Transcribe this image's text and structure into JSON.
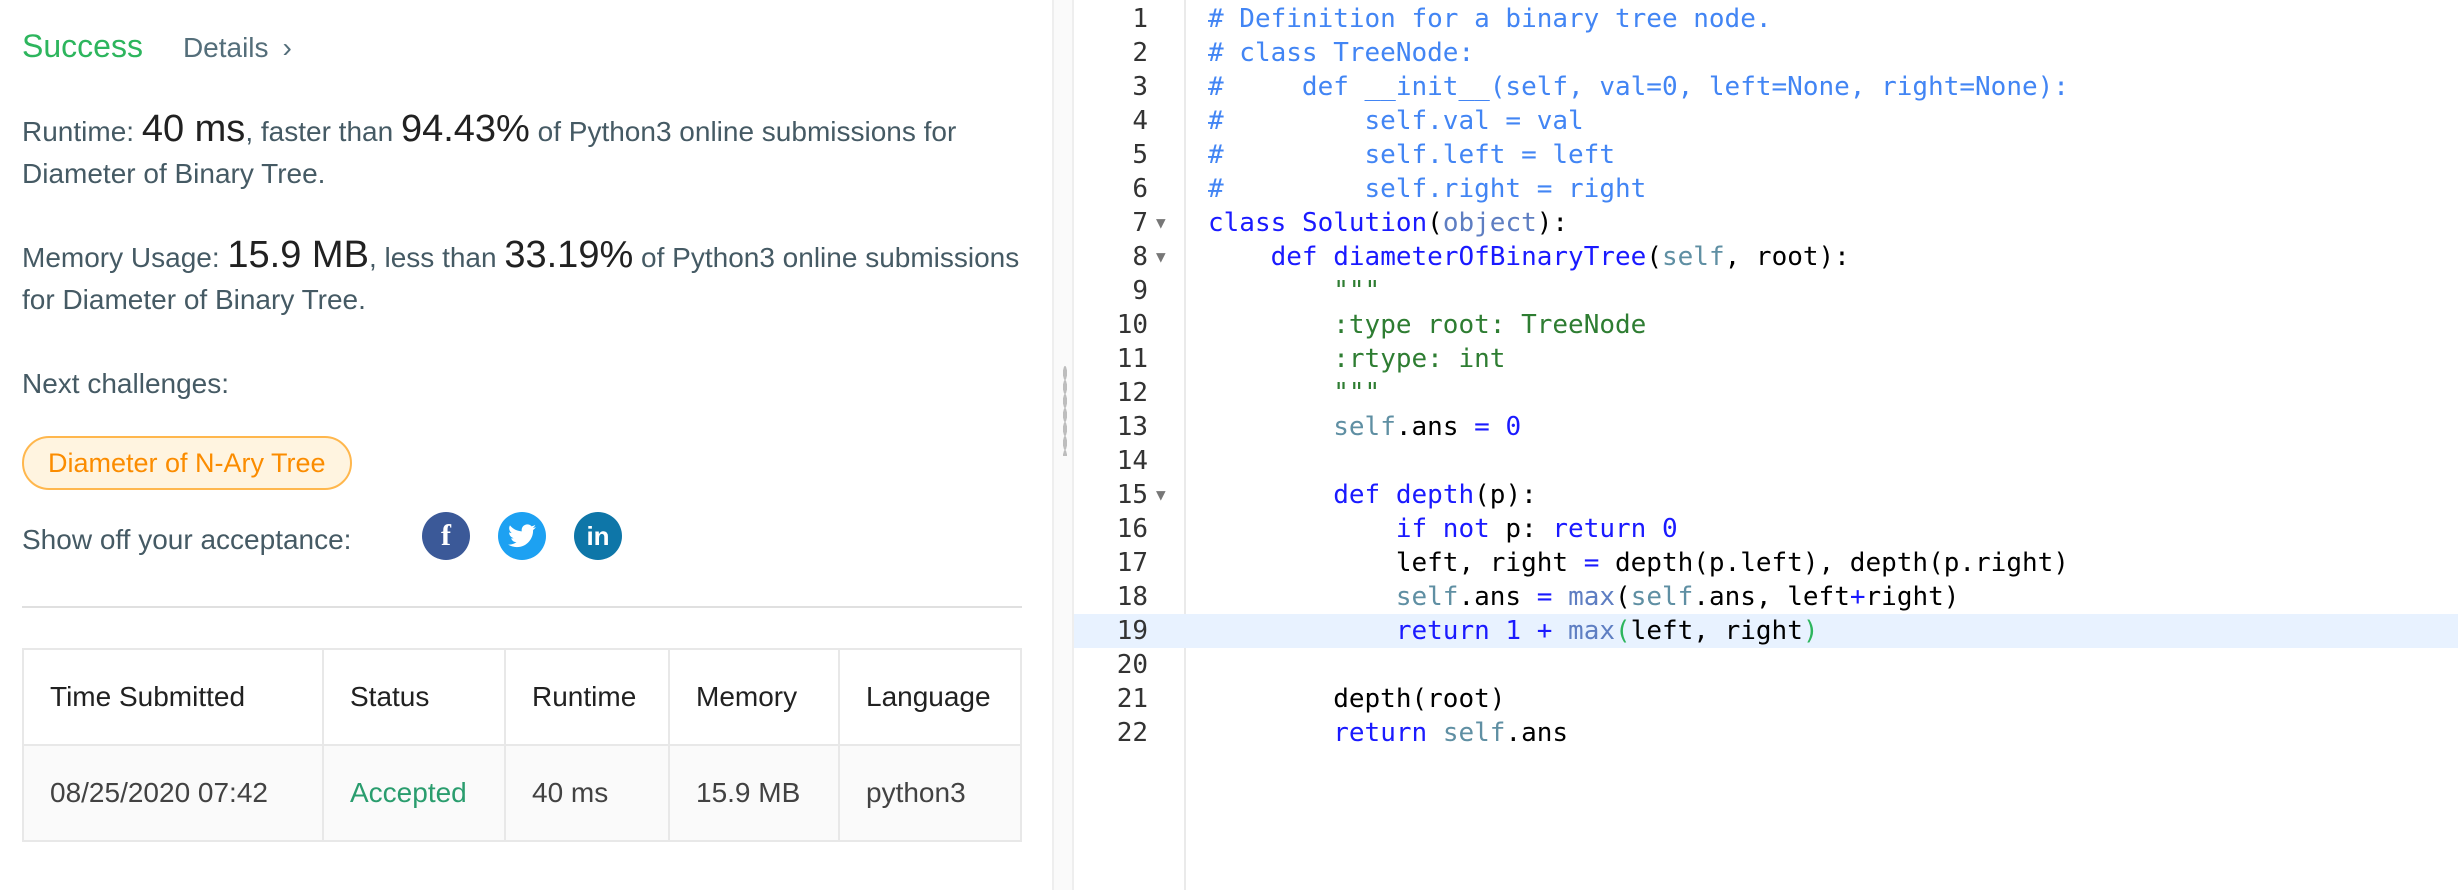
{
  "header": {
    "status": "Success",
    "details_label": "Details",
    "details_chevron": "›"
  },
  "runtime": {
    "label": "Runtime:",
    "value": "40 ms",
    "mid": ", faster than",
    "percent": "94.43%",
    "tail": "of Python3 online submissions for Diameter of Binary Tree."
  },
  "memory": {
    "label": "Memory Usage:",
    "value": "15.9 MB",
    "mid": ", less than",
    "percent": "33.19%",
    "tail": "of Python3 online submissions for Diameter of Binary Tree."
  },
  "next": {
    "label": "Next challenges:",
    "chip": "Diameter of N-Ary Tree"
  },
  "share": {
    "label": "Show off your acceptance:",
    "icons": [
      "facebook-icon",
      "twitter-icon",
      "linkedin-icon"
    ],
    "fb_glyph": "f",
    "li_glyph": "in"
  },
  "table": {
    "headers": [
      "Time Submitted",
      "Status",
      "Runtime",
      "Memory",
      "Language"
    ],
    "row": [
      "08/25/2020 07:42",
      "Accepted",
      "40 ms",
      "15.9 MB",
      "python3"
    ]
  },
  "colors": {
    "success": "#2db55d",
    "chip_border": "#ffb74d",
    "chip_text": "#fb8c00",
    "facebook": "#3b5998",
    "twitter": "#1da1f2",
    "linkedin": "#0e76a8"
  },
  "editor": {
    "active_line": 19,
    "fold_lines": [
      7,
      8,
      15
    ],
    "lines": [
      [
        [
          "c-com",
          "# Definition for a binary tree node."
        ]
      ],
      [
        [
          "c-com",
          "# class TreeNode:"
        ]
      ],
      [
        [
          "c-com",
          "#     def __init__(self, val=0, left=None, right=None):"
        ]
      ],
      [
        [
          "c-com",
          "#         self.val = val"
        ]
      ],
      [
        [
          "c-com",
          "#         self.left = left"
        ]
      ],
      [
        [
          "c-com",
          "#         self.right = right"
        ]
      ],
      [
        [
          "c-kw",
          "class"
        ],
        [
          "",
          " "
        ],
        [
          "c-fn",
          "Solution"
        ],
        [
          "",
          "("
        ],
        [
          "c-builtin",
          "object"
        ],
        [
          "",
          "):"
        ]
      ],
      [
        [
          "",
          "    "
        ],
        [
          "c-kw",
          "def"
        ],
        [
          "",
          " "
        ],
        [
          "c-fn",
          "diameterOfBinaryTree"
        ],
        [
          "",
          "("
        ],
        [
          "c-self",
          "self"
        ],
        [
          "",
          ", root):"
        ]
      ],
      [
        [
          "",
          "        "
        ],
        [
          "c-str",
          "\"\"\""
        ]
      ],
      [
        [
          "",
          "        "
        ],
        [
          "c-str",
          ":type root: TreeNode"
        ]
      ],
      [
        [
          "",
          "        "
        ],
        [
          "c-str",
          ":rtype: int"
        ]
      ],
      [
        [
          "",
          "        "
        ],
        [
          "c-str",
          "\"\"\""
        ]
      ],
      [
        [
          "",
          "        "
        ],
        [
          "c-self",
          "self"
        ],
        [
          "",
          ".ans "
        ],
        [
          "c-op",
          "="
        ],
        [
          "",
          " "
        ],
        [
          "c-num",
          "0"
        ]
      ],
      [
        [
          "",
          ""
        ]
      ],
      [
        [
          "",
          "        "
        ],
        [
          "c-kw",
          "def"
        ],
        [
          "",
          " "
        ],
        [
          "c-fn",
          "depth"
        ],
        [
          "",
          "(p):"
        ]
      ],
      [
        [
          "",
          "            "
        ],
        [
          "c-kw",
          "if not"
        ],
        [
          "",
          " p: "
        ],
        [
          "c-kw",
          "return"
        ],
        [
          "",
          " "
        ],
        [
          "c-num",
          "0"
        ]
      ],
      [
        [
          "",
          "            left, right "
        ],
        [
          "c-op",
          "="
        ],
        [
          "",
          " depth(p.left), depth(p.right)"
        ]
      ],
      [
        [
          "",
          "            "
        ],
        [
          "c-self",
          "self"
        ],
        [
          "",
          ".ans "
        ],
        [
          "c-op",
          "="
        ],
        [
          "",
          " "
        ],
        [
          "c-builtin",
          "max"
        ],
        [
          "",
          "("
        ],
        [
          "c-self",
          "self"
        ],
        [
          "",
          ".ans, left"
        ],
        [
          "c-op",
          "+"
        ],
        [
          "",
          "right)"
        ]
      ],
      [
        [
          "",
          "            "
        ],
        [
          "c-kw",
          "return"
        ],
        [
          "",
          " "
        ],
        [
          "c-num",
          "1"
        ],
        [
          "",
          " "
        ],
        [
          "c-op",
          "+"
        ],
        [
          "",
          " "
        ],
        [
          "c-builtin",
          "max"
        ],
        [
          "c-paren-hl",
          "("
        ],
        [
          "",
          "left, right"
        ],
        [
          "c-paren-hl",
          ")"
        ]
      ],
      [
        [
          "",
          ""
        ]
      ],
      [
        [
          "",
          "        depth(root)"
        ]
      ],
      [
        [
          "",
          "        "
        ],
        [
          "c-kw",
          "return"
        ],
        [
          "",
          " "
        ],
        [
          "c-self",
          "self"
        ],
        [
          "",
          ".ans"
        ]
      ]
    ]
  }
}
